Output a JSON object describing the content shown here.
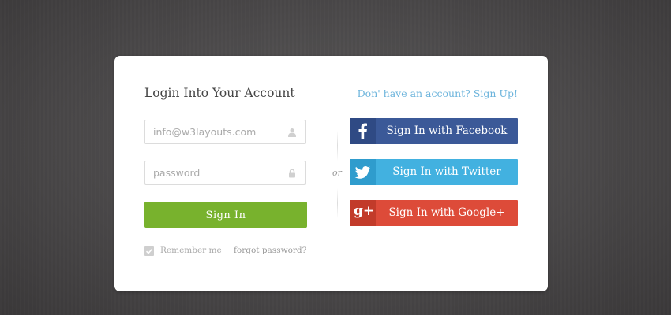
{
  "login": {
    "title": "Login Into Your Account",
    "signup_link": "Don' have an account? Sign Up!",
    "email_placeholder": "info@w3layouts.com",
    "password_placeholder": "password",
    "signin_button": "Sign In",
    "remember_label": "Remember me",
    "remember_checked": true,
    "forgot_link": "forgot password?"
  },
  "divider": {
    "or_text": "or"
  },
  "social": {
    "facebook_label": "Sign In with Facebook",
    "twitter_label": "Sign In with Twitter",
    "google_label": "Sign In with Google+",
    "google_icon_text": "g+",
    "icons": [
      "facebook-icon",
      "twitter-icon",
      "google-plus-icon"
    ]
  },
  "colors": {
    "signin_green": "#78b22d",
    "facebook_blue": "#3b5998",
    "twitter_blue": "#42b1e0",
    "google_red": "#dd4b39",
    "link_blue": "#6cb4dc"
  }
}
